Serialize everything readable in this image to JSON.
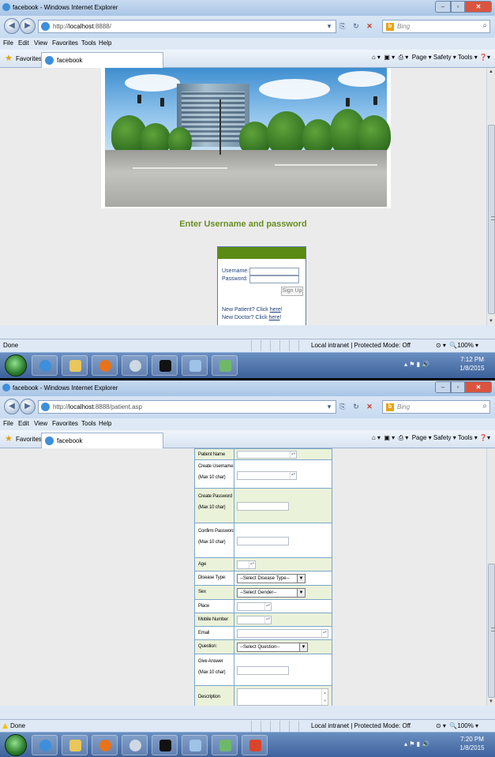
{
  "screen1": {
    "window_title": "facebook - Windows Internet Explorer",
    "address": {
      "prefix": "http://",
      "host": "localhost",
      "rest": ":8888/"
    },
    "search_placeholder": "Bing",
    "menu": [
      "File",
      "Edit",
      "View",
      "Favorites",
      "Tools",
      "Help"
    ],
    "favorites_label": "Favorites",
    "tab_label": "facebook",
    "command_bar": "Page ▾  Safety ▾  Tools ▾",
    "login": {
      "heading": "Enter Username and password",
      "username_label": "Username:",
      "password_label": "Password:",
      "signup_label": "Sign Up",
      "new_patient_prefix": "New Patient? Click ",
      "new_doctor_prefix": "New Doctor? Click ",
      "link_text": "here",
      "suffix": "!"
    },
    "status": {
      "left": "Done",
      "zone": "Local intranet | Protected Mode: Off",
      "zoom": "100%"
    },
    "clock": {
      "time": "7:12 PM",
      "date": "1/8/2015"
    }
  },
  "screen2": {
    "window_title": "facebook - Windows Internet Explorer",
    "address": {
      "prefix": "http://",
      "host": "localhost",
      "rest": ":8888/patient.asp"
    },
    "search_placeholder": "Bing",
    "menu": [
      "File",
      "Edit",
      "View",
      "Favorites",
      "Tools",
      "Help"
    ],
    "favorites_label": "Favorites",
    "tab_label": "facebook",
    "command_bar": "Page ▾  Safety ▾  Tools ▾",
    "form": {
      "patient_name": "Patient Name",
      "create_username": "Create Username",
      "max10": "(Max 10 char)",
      "create_password": "Create Password",
      "confirm_password": "Confirm Password",
      "age": "Age",
      "disease_type": "Disease Type:",
      "disease_select": "--Select Disease Type--",
      "sex": "Sex",
      "gender_select": "--Select Gender--",
      "place": "Place",
      "mobile": "Mobile Number",
      "email": "Email",
      "question": "Question:",
      "question_select": "--Select Question--",
      "give_answer": "Give Answer",
      "description": "Description"
    },
    "status": {
      "left": "Done",
      "zone": "Local intranet | Protected Mode: Off",
      "zoom": "100%"
    },
    "clock": {
      "time": "7:20 PM",
      "date": "1/8/2015"
    }
  },
  "colors": {
    "heading_green": "#6b8e23",
    "login_header": "#5a8a14",
    "form_alt_row": "#ebf2da",
    "form_border": "#7aa7c7"
  }
}
